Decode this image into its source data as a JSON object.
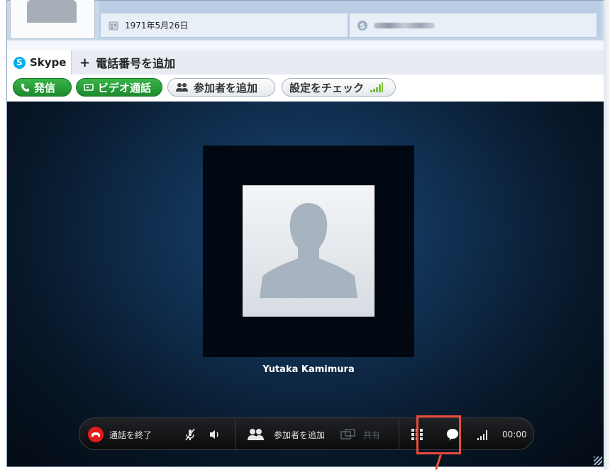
{
  "profile": {
    "birthday": "1971年5月26日",
    "birthday_icon": "birthday-icon",
    "skype_icon": "skype-icon"
  },
  "tabs": [
    {
      "label": "Skype",
      "icon": "skype-logo-icon"
    },
    {
      "label": "電話番号を追加",
      "icon": "plus-icon"
    }
  ],
  "toolbar": {
    "call_label": "発信",
    "video_call_label": "ビデオ通話",
    "add_participant_label": "参加者を追加",
    "check_settings_label": "設定をチェック"
  },
  "call": {
    "caller_name": "Yutaka Kamimura",
    "end_call_label": "通話を終了",
    "add_participant_label": "参加者を追加",
    "share_label": "共有",
    "timer": "00:00"
  },
  "colors": {
    "accent_green": "#1c8b2c",
    "end_call_red": "#e21c1c",
    "highlight_red": "#e94b3c",
    "skype_blue": "#00aff0"
  }
}
